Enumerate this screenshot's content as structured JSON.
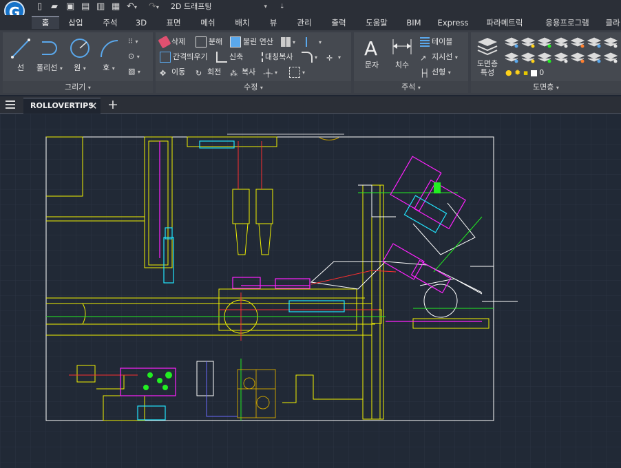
{
  "app": {
    "logo_letter": "G",
    "workspace": "2D 드래프팅"
  },
  "quick_access_icons": [
    "new-file-icon",
    "open-folder-icon",
    "save-icon",
    "save-as-icon",
    "plot-icon",
    "print-icon",
    "undo-icon",
    "redo-icon"
  ],
  "tabs": [
    {
      "label": "홈",
      "active": true
    },
    {
      "label": "삽입"
    },
    {
      "label": "주석"
    },
    {
      "label": "3D"
    },
    {
      "label": "표면"
    },
    {
      "label": "메쉬"
    },
    {
      "label": "배치"
    },
    {
      "label": "뷰"
    },
    {
      "label": "관리"
    },
    {
      "label": "출력"
    },
    {
      "label": "도움말"
    },
    {
      "label": "BIM"
    },
    {
      "label": "Express"
    },
    {
      "label": "파라메트릭"
    },
    {
      "label": "응용프로그램"
    },
    {
      "label": "클라"
    }
  ],
  "ribbon": {
    "draw": {
      "label": "그리기",
      "tools": [
        {
          "label": "선"
        },
        {
          "label": "폴리선"
        },
        {
          "label": "원"
        },
        {
          "label": "호"
        }
      ]
    },
    "modify": {
      "label": "수정",
      "tools": [
        {
          "label": "삭제"
        },
        {
          "label": "분해"
        },
        {
          "label": "불린 연산"
        },
        {
          "label": "간격띄우기"
        },
        {
          "label": "신축"
        },
        {
          "label": "대칭복사"
        },
        {
          "label": "이동"
        },
        {
          "label": "회전"
        },
        {
          "label": "복사"
        }
      ]
    },
    "annotation": {
      "label": "주석",
      "tools": [
        {
          "label": "문자"
        },
        {
          "label": "치수"
        },
        {
          "label": "테이블"
        },
        {
          "label": "지시선"
        },
        {
          "label": "선형"
        }
      ]
    },
    "layers": {
      "label": "도면층",
      "properties_label": "도면층\n특성",
      "current_layer": "0"
    }
  },
  "document_tabs": [
    {
      "label": "ROLLOVERTIPS",
      "active": true
    }
  ],
  "colors": {
    "accent": "#1673c9",
    "canvas": "#212936",
    "frame": "#ffffff",
    "yellow": "#f2f200",
    "magenta": "#ff22ff",
    "cyan": "#22e6ff",
    "green": "#22ee22",
    "red": "#ff3030"
  }
}
